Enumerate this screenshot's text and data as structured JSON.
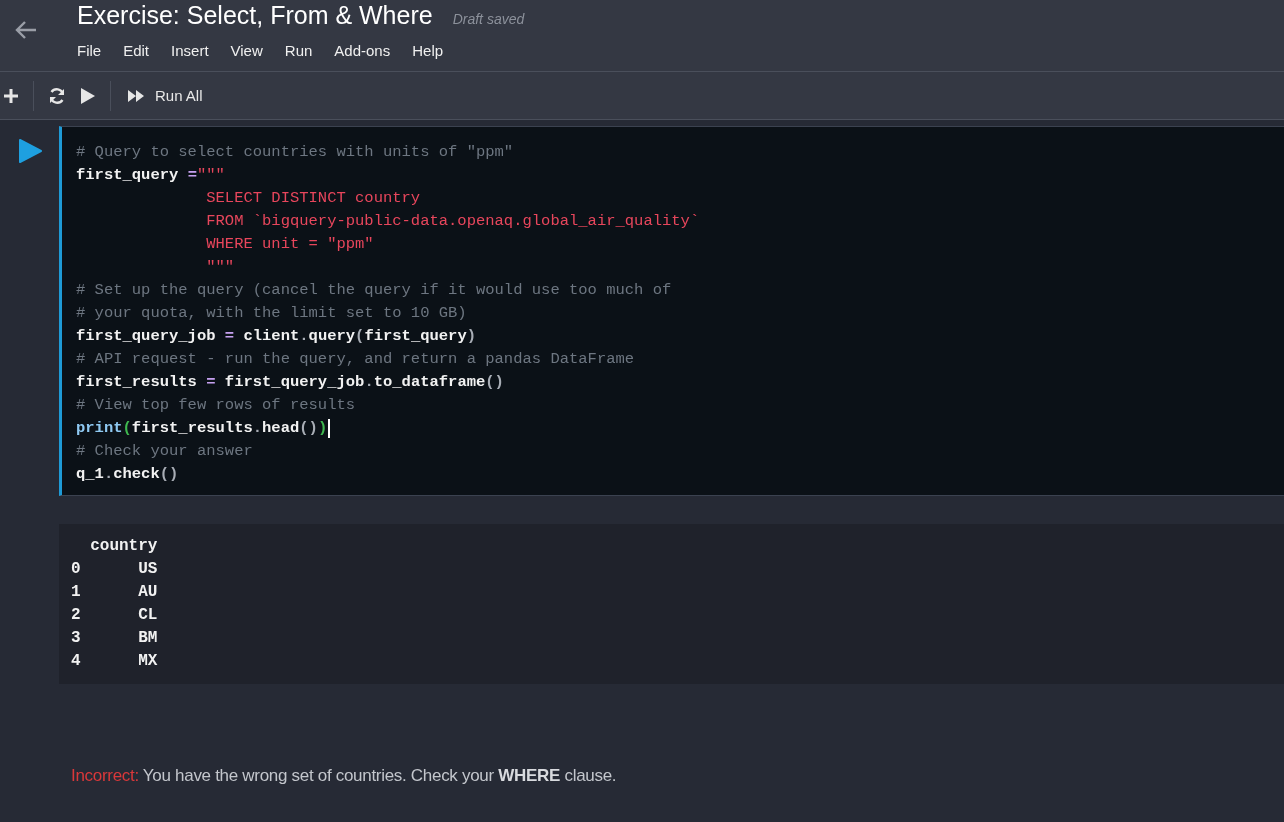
{
  "header": {
    "title": "Exercise: Select, From & Where",
    "save_status": "Draft saved",
    "menu": [
      "File",
      "Edit",
      "Insert",
      "View",
      "Run",
      "Add-ons",
      "Help"
    ]
  },
  "toolbar": {
    "run_all_label": "Run All"
  },
  "code_cell": {
    "lines": [
      [
        {
          "kind": "comment",
          "text": "# Query to select countries with units of \"ppm\""
        }
      ],
      [
        {
          "kind": "name",
          "text": "first_query "
        },
        {
          "kind": "op",
          "text": "="
        },
        {
          "kind": "string",
          "text": "\"\"\""
        }
      ],
      [
        {
          "kind": "string",
          "text": "              SELECT DISTINCT country"
        }
      ],
      [
        {
          "kind": "string",
          "text": "              FROM `bigquery-public-data.openaq.global_air_quality`"
        }
      ],
      [
        {
          "kind": "string",
          "text": "              WHERE unit = \"ppm\""
        }
      ],
      [
        {
          "kind": "string",
          "text": "              \"\"\""
        }
      ],
      [
        {
          "kind": "comment",
          "text": "# Set up the query (cancel the query if it would use too much of"
        }
      ],
      [
        {
          "kind": "comment",
          "text": "# your quota, with the limit set to 10 GB)"
        }
      ],
      [
        {
          "kind": "name",
          "text": "first_query_job "
        },
        {
          "kind": "op",
          "text": "="
        },
        {
          "kind": "name",
          "text": " client"
        },
        {
          "kind": "punct",
          "text": "."
        },
        {
          "kind": "name",
          "text": "query"
        },
        {
          "kind": "punct",
          "text": "("
        },
        {
          "kind": "name",
          "text": "first_query"
        },
        {
          "kind": "punct",
          "text": ")"
        }
      ],
      [
        {
          "kind": "comment",
          "text": "# API request - run the query, and return a pandas DataFrame"
        }
      ],
      [
        {
          "kind": "name",
          "text": "first_results "
        },
        {
          "kind": "op",
          "text": "="
        },
        {
          "kind": "name",
          "text": " first_query_job"
        },
        {
          "kind": "punct",
          "text": "."
        },
        {
          "kind": "name",
          "text": "to_dataframe"
        },
        {
          "kind": "punct",
          "text": "()"
        }
      ],
      [
        {
          "kind": "comment",
          "text": "# View top few rows of results"
        }
      ],
      [
        {
          "kind": "builtin",
          "text": "print"
        },
        {
          "kind": "bracket",
          "text": "("
        },
        {
          "kind": "name",
          "text": "first_results"
        },
        {
          "kind": "punct",
          "text": "."
        },
        {
          "kind": "name",
          "text": "head"
        },
        {
          "kind": "punct",
          "text": "()"
        },
        {
          "kind": "bracket",
          "text": ")"
        },
        {
          "kind": "cursor"
        }
      ],
      [
        {
          "kind": "comment",
          "text": "# Check your answer"
        }
      ],
      [
        {
          "kind": "name",
          "text": "q_1"
        },
        {
          "kind": "punct",
          "text": "."
        },
        {
          "kind": "name",
          "text": "check"
        },
        {
          "kind": "punct",
          "text": "()"
        }
      ]
    ]
  },
  "output": {
    "lines": [
      "  country",
      "0      US",
      "1      AU",
      "2      CL",
      "3      BM",
      "4      MX"
    ]
  },
  "feedback": {
    "status": "Incorrect:",
    "message": "You have the wrong set of countries. Check your **WHERE** clause."
  }
}
